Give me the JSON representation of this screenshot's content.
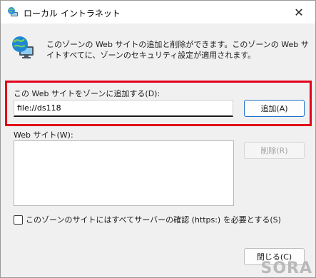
{
  "window": {
    "title": "ローカル イントラネット",
    "close_glyph": "✕"
  },
  "info": {
    "text": "このゾーンの Web サイトの追加と削除ができます。このゾーンの Web サイトすべてに、ゾーンのセキュリティ設定が適用されます。"
  },
  "add_section": {
    "label": "この Web サイトをゾーンに追加する(D):",
    "input_value": "file://ds118",
    "add_button": "追加(A)"
  },
  "sites_section": {
    "label": "Web サイト(W):",
    "items": [],
    "remove_button": "削除(R)"
  },
  "https_option": {
    "label": "このゾーンのサイトにはすべてサーバーの確認 (https:) を必要とする(S)",
    "checked": false
  },
  "footer": {
    "close_button": "閉じる(C)"
  },
  "watermark": "SORA",
  "colors": {
    "highlight_border": "#e2001a",
    "accent": "#1a6fc9"
  },
  "icons": {
    "window": "globe-computer-icon",
    "info": "globe-computer-icon",
    "close": "close-icon"
  }
}
